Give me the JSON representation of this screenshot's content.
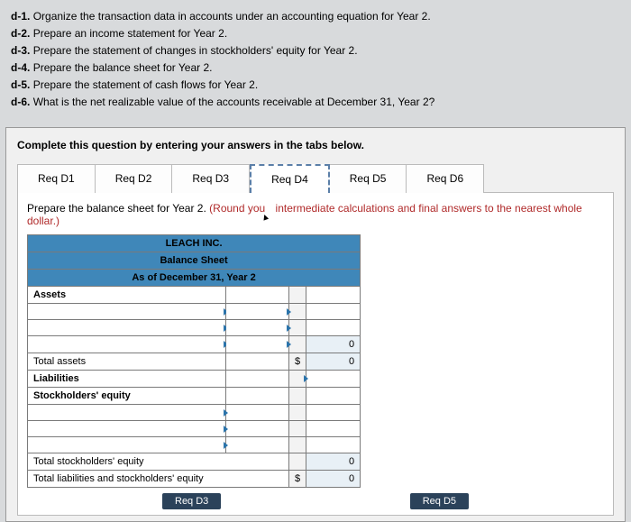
{
  "questions": [
    {
      "id": "d-1.",
      "text": "Organize the transaction data in accounts under an accounting equation for Year 2."
    },
    {
      "id": "d-2.",
      "text": "Prepare an income statement for Year 2."
    },
    {
      "id": "d-3.",
      "text": "Prepare the statement of changes in stockholders' equity for Year 2."
    },
    {
      "id": "d-4.",
      "text": "Prepare the balance sheet for Year 2."
    },
    {
      "id": "d-5.",
      "text": "Prepare the statement of cash flows for Year 2."
    },
    {
      "id": "d-6.",
      "text": "What is the net realizable value of the accounts receivable at December 31, Year 2?"
    }
  ],
  "panel": {
    "instruction": "Complete this question by entering your answers in the tabs below.",
    "tabs": [
      "Req D1",
      "Req D2",
      "Req D3",
      "Req D4",
      "Req D5",
      "Req D6"
    ],
    "activeTab": "Req D4",
    "tabDescPrefix": "Prepare the balance sheet for Year 2. ",
    "tabDescNote1": "(Round you",
    "tabDescNote2": " intermediate calculations and final answers to the nearest whole dollar.)"
  },
  "sheet": {
    "company": "LEACH INC.",
    "title": "Balance Sheet",
    "asof": "As of December 31, Year 2",
    "row_assets": "Assets",
    "row_total_assets": "Total assets",
    "row_liabilities": "Liabilities",
    "row_se": "Stockholders' equity",
    "row_total_se": "Total stockholders' equity",
    "row_total_liab_se": "Total liabilities and stockholders' equity",
    "currency": "$",
    "zero": "0"
  },
  "pager": {
    "prev": "Req D3",
    "next": "Req D5"
  }
}
